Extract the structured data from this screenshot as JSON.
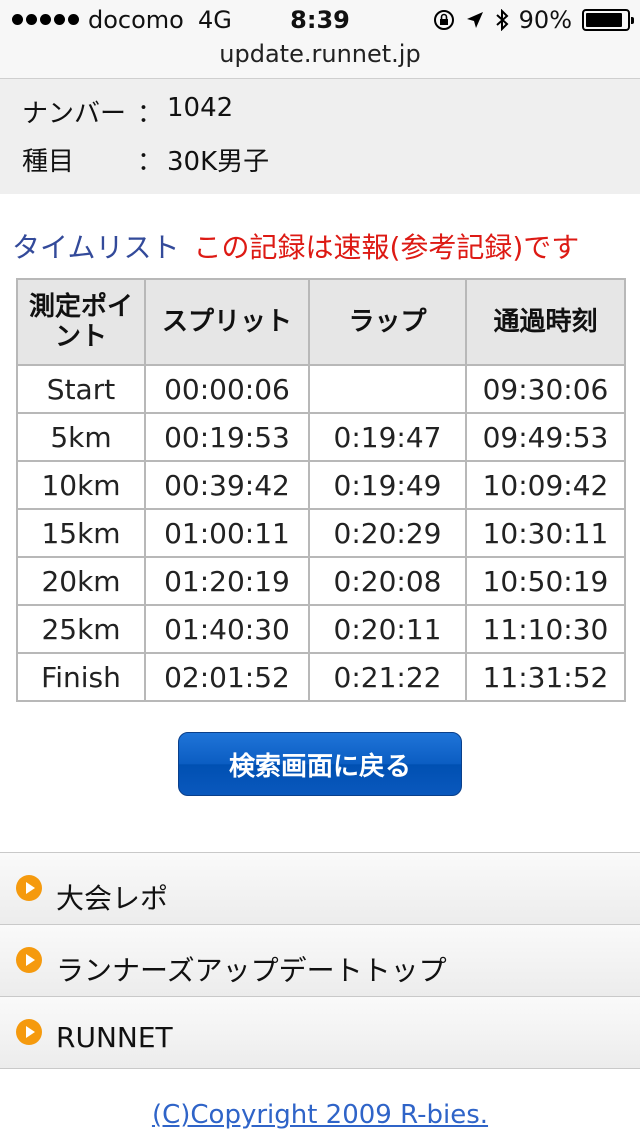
{
  "status_bar": {
    "carrier": "docomo",
    "network": "4G",
    "time": "8:39",
    "battery_percent": "90%",
    "battery_level": 0.9
  },
  "browser": {
    "url": "update.runnet.jp"
  },
  "info": [
    {
      "key": "ナンバー",
      "sep": "：",
      "value": "1042"
    },
    {
      "key": "種目",
      "sep": "：",
      "value": "30K男子"
    }
  ],
  "time_list": {
    "title": "タイムリスト",
    "notice": "この記録は速報(参考記録)です"
  },
  "table": {
    "headers": [
      "測定ポイント",
      "スプリット",
      "ラップ",
      "通過時刻"
    ],
    "rows": [
      [
        "Start",
        "00:00:06",
        "",
        "09:30:06"
      ],
      [
        "5km",
        "00:19:53",
        "0:19:47",
        "09:49:53"
      ],
      [
        "10km",
        "00:39:42",
        "0:19:49",
        "10:09:42"
      ],
      [
        "15km",
        "01:00:11",
        "0:20:29",
        "10:30:11"
      ],
      [
        "20km",
        "01:20:19",
        "0:20:08",
        "10:50:19"
      ],
      [
        "25km",
        "01:40:30",
        "0:20:11",
        "11:10:30"
      ],
      [
        "Finish",
        "02:01:52",
        "0:21:22",
        "11:31:52"
      ]
    ]
  },
  "back_button": {
    "label": "検索画面に戻る"
  },
  "nav": [
    {
      "label": "大会レポ"
    },
    {
      "label": "ランナーズアップデートトップ"
    },
    {
      "label": "RUNNET"
    }
  ],
  "footer": {
    "copyright": "(C)Copyright 2009 R-bies."
  },
  "colors": {
    "link_blue": "#334a9a",
    "notice_red": "#dd1a14",
    "button_blue": "#0b5dc2",
    "bullet_orange": "#f59a0e"
  }
}
